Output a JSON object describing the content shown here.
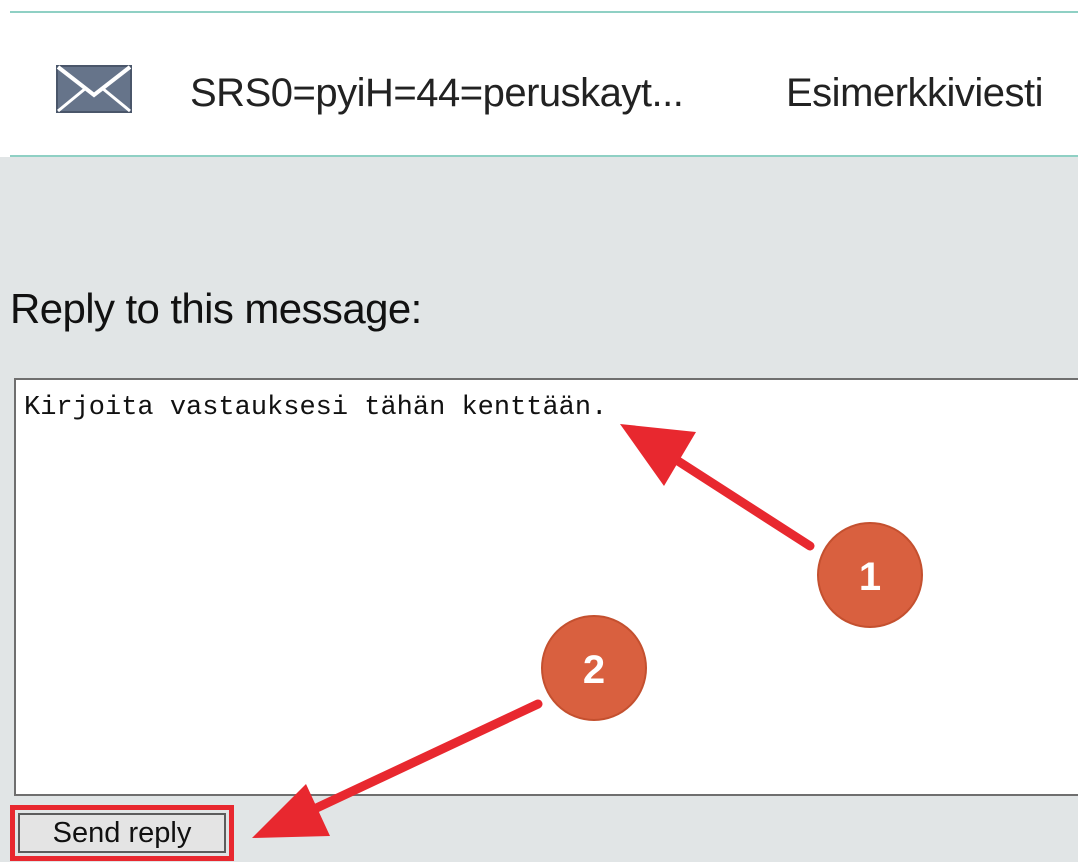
{
  "message_header": {
    "icon": "envelope-icon",
    "sender": "SRS0=pyiH=44=peruskayt...",
    "subject": "Esimerkkiviesti"
  },
  "reply": {
    "heading": "Reply to this message:",
    "textarea_value": "Kirjoita vastauksesi tähän kenttään.",
    "send_label": "Send reply"
  },
  "annotations": {
    "step_1": "1",
    "step_2": "2",
    "badge_color": "#d9603f",
    "arrow_color": "#e8282f"
  },
  "colors": {
    "divider": "#8fd0c4",
    "panel_background": "#e1e5e6",
    "highlight": "#e8282f"
  }
}
